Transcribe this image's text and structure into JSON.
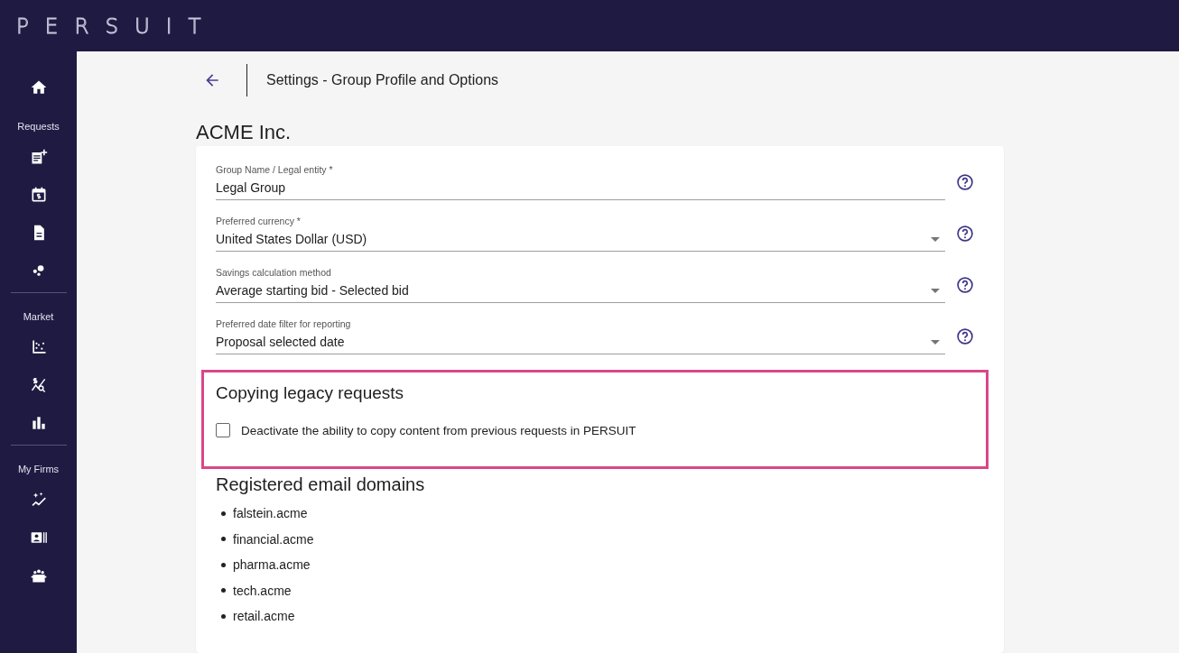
{
  "brand": {
    "logo": "PERSUIT"
  },
  "sidebar": {
    "sections": [
      {
        "label": "Requests"
      },
      {
        "label": "Market"
      },
      {
        "label": "My Firms"
      }
    ]
  },
  "header": {
    "title": "Settings - Group Profile and Options"
  },
  "group": {
    "name": "ACME Inc."
  },
  "fields": [
    {
      "label": "Group Name / Legal entity *",
      "value": "Legal Group",
      "kind": "text"
    },
    {
      "label": "Preferred currency *",
      "value": "United States Dollar (USD)",
      "kind": "select"
    },
    {
      "label": "Savings calculation method",
      "value": "Average starting bid - Selected bid",
      "kind": "select"
    },
    {
      "label": "Preferred date filter for reporting",
      "value": "Proposal selected date",
      "kind": "select"
    }
  ],
  "legacy": {
    "title": "Copying legacy requests",
    "highlighted": true,
    "option": {
      "label": "Deactivate the ability to copy content from previous requests in PERSUIT",
      "checked": false
    }
  },
  "domains": {
    "title": "Registered email domains",
    "items": [
      "falstein.acme",
      "financial.acme",
      "pharma.acme",
      "tech.acme",
      "retail.acme"
    ]
  }
}
